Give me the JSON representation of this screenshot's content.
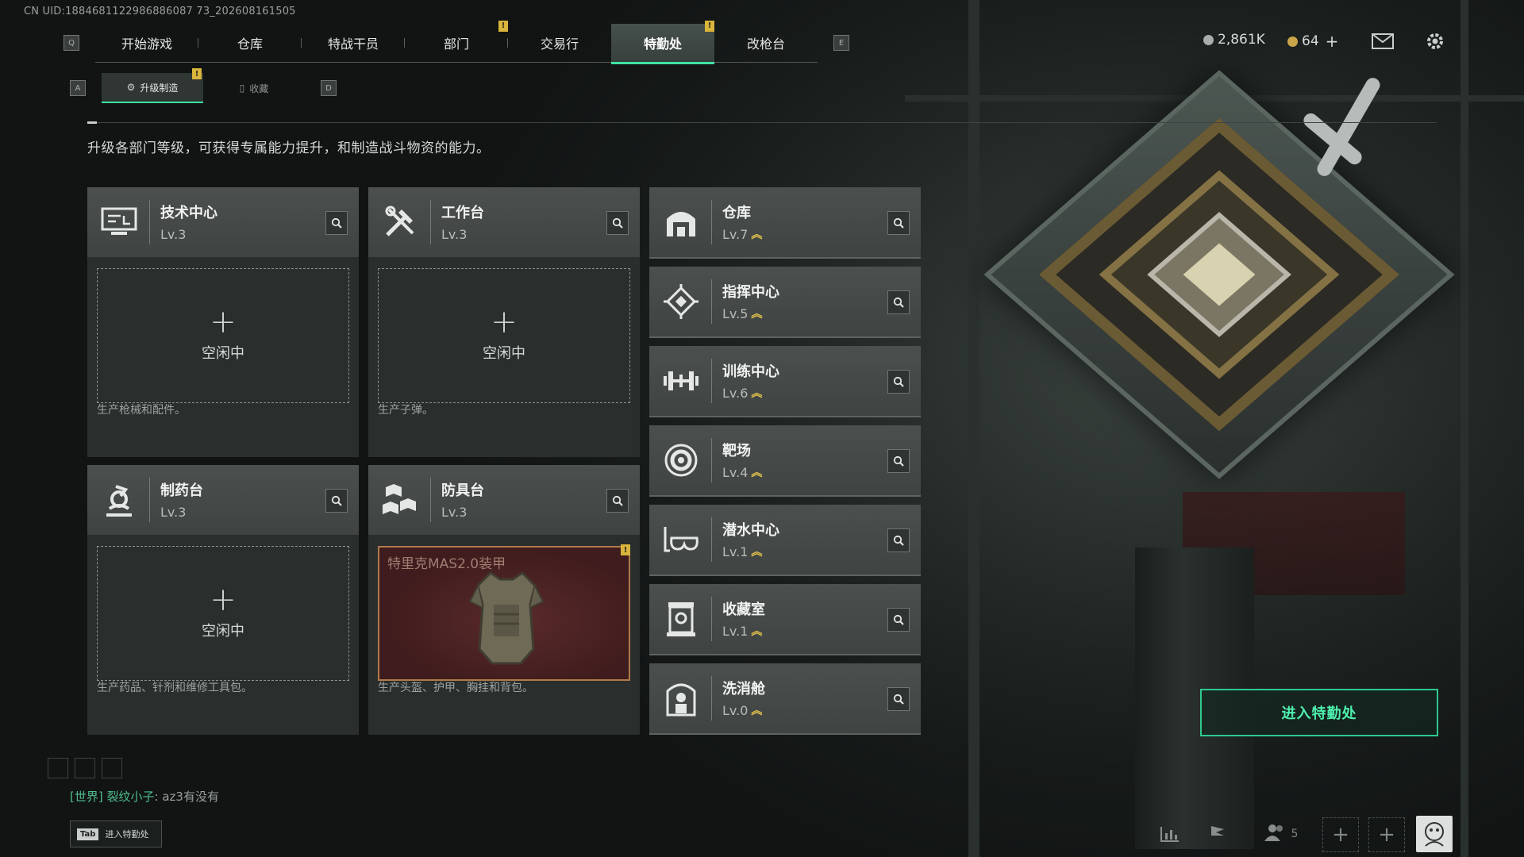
{
  "uid": "CN UID:1884681122986886087 73_202608161505",
  "nav": {
    "key_left": "Q",
    "key_right": "E",
    "tabs": [
      {
        "label": "开始游戏"
      },
      {
        "label": "仓库"
      },
      {
        "label": "特战干员"
      },
      {
        "label": "部门",
        "badge": "!"
      },
      {
        "label": "交易行"
      },
      {
        "label": "特勤处",
        "badge": "!",
        "active": true
      },
      {
        "label": "改枪台"
      }
    ]
  },
  "currency": {
    "silver": "2,861K",
    "gold": "64",
    "gold_add": "+"
  },
  "subnav": {
    "key_left": "A",
    "key_right": "D",
    "tabs": [
      {
        "label": "升级制造",
        "badge": "!",
        "active": true
      },
      {
        "label": "收藏"
      }
    ]
  },
  "description": "升级各部门等级，可获得专属能力提升，和制造战斗物资的能力。",
  "departments_main": [
    {
      "name": "技术中心",
      "level": "Lv.3",
      "icon": "tech-center-icon",
      "slot": "空闲中",
      "desc": "生产枪械和配件。"
    },
    {
      "name": "工作台",
      "level": "Lv.3",
      "icon": "workbench-icon",
      "slot": "空闲中",
      "desc": "生产子弹。"
    },
    {
      "name": "制药台",
      "level": "Lv.3",
      "icon": "pharmacy-icon",
      "slot": "空闲中",
      "desc": "生产药品、针剂和维修工具包。"
    },
    {
      "name": "防具台",
      "level": "Lv.3",
      "icon": "armor-bench-icon",
      "item": "特里克MAS2.0装甲",
      "item_badge": "!",
      "desc": "生产头盔、护甲、胸挂和背包。"
    }
  ],
  "slot_plus": "+",
  "departments_side": [
    {
      "name": "仓库",
      "level": "Lv.7",
      "icon": "warehouse-icon"
    },
    {
      "name": "指挥中心",
      "level": "Lv.5",
      "icon": "command-center-icon"
    },
    {
      "name": "训练中心",
      "level": "Lv.6",
      "icon": "training-center-icon"
    },
    {
      "name": "靶场",
      "level": "Lv.4",
      "icon": "shooting-range-icon"
    },
    {
      "name": "潜水中心",
      "level": "Lv.1",
      "icon": "diving-center-icon"
    },
    {
      "name": "收藏室",
      "level": "Lv.1",
      "icon": "collection-room-icon"
    },
    {
      "name": "洗消舱",
      "level": "Lv.0",
      "icon": "decon-chamber-icon"
    }
  ],
  "enter_button": "进入特勤处",
  "chat": {
    "channel": "[世界]",
    "user": "裂纹小子",
    "message": ": az3有没有"
  },
  "tab_hint": {
    "key": "Tab",
    "label": "进入特勤处"
  },
  "bottom": {
    "friends_count": "5",
    "add": "+"
  },
  "colors": {
    "accent": "#3fe3a3",
    "badge": "#d9b53b",
    "level_up": "#e5c24b"
  }
}
